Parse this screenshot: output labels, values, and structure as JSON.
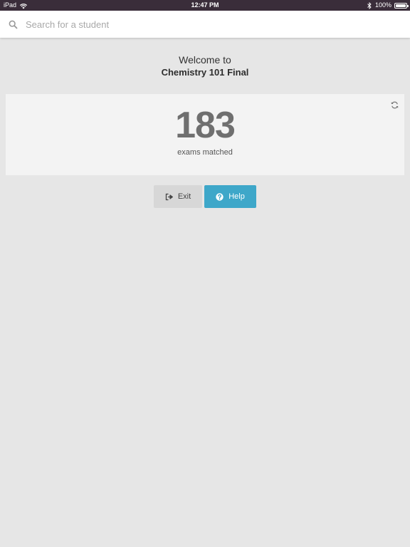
{
  "status_bar": {
    "device": "iPad",
    "time": "12:47 PM",
    "battery": "100%"
  },
  "search": {
    "placeholder": "Search for a student",
    "value": ""
  },
  "welcome": {
    "line1": "Welcome to",
    "exam_name": "Chemistry 101 Final"
  },
  "summary": {
    "count": "183",
    "label": "exams matched"
  },
  "actions": {
    "exit_label": "Exit",
    "help_label": "Help"
  },
  "colors": {
    "background": "#e6e6e6",
    "status_bar": "#3a2d3a",
    "help_button": "#3ea7c9",
    "exit_button": "#d7d7d7"
  },
  "icons": [
    "wifi-icon",
    "bluetooth-icon",
    "battery-icon",
    "search-icon",
    "refresh-icon",
    "sign-out-icon",
    "question-circle-icon"
  ]
}
